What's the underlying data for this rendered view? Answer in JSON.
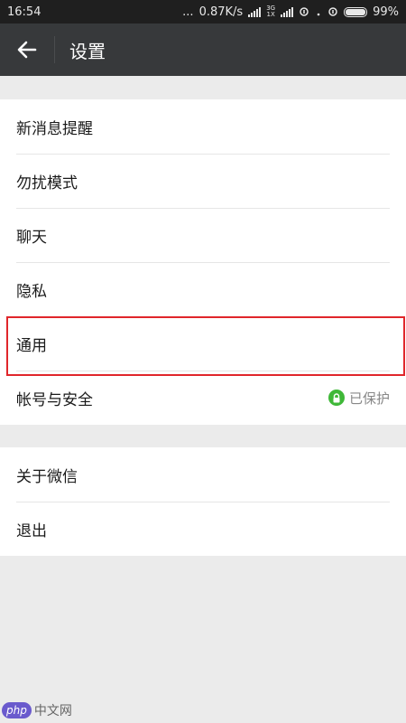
{
  "status_bar": {
    "time": "16:54",
    "dots": "...",
    "speed": "0.87K/s",
    "net_top": "3G",
    "net_bottom": "1X",
    "battery_percent": "99%",
    "battery_level": 0.99
  },
  "app_bar": {
    "back_icon": "arrow-left-icon",
    "title": "设置"
  },
  "group1": {
    "items": [
      {
        "label": "新消息提醒"
      },
      {
        "label": "勿扰模式"
      },
      {
        "label": "聊天"
      },
      {
        "label": "隐私"
      },
      {
        "label": "通用"
      },
      {
        "label": "帐号与安全",
        "aside": "已保护",
        "aside_icon": "lock-icon"
      }
    ]
  },
  "group2": {
    "items": [
      {
        "label": "关于微信"
      },
      {
        "label": "退出"
      }
    ]
  },
  "watermark": {
    "logo": "php",
    "text": "中文网"
  },
  "colors": {
    "app_bar": "#37393b",
    "background": "#ebebeb",
    "highlight": "#e0262b",
    "protected_green": "#3fb838"
  }
}
